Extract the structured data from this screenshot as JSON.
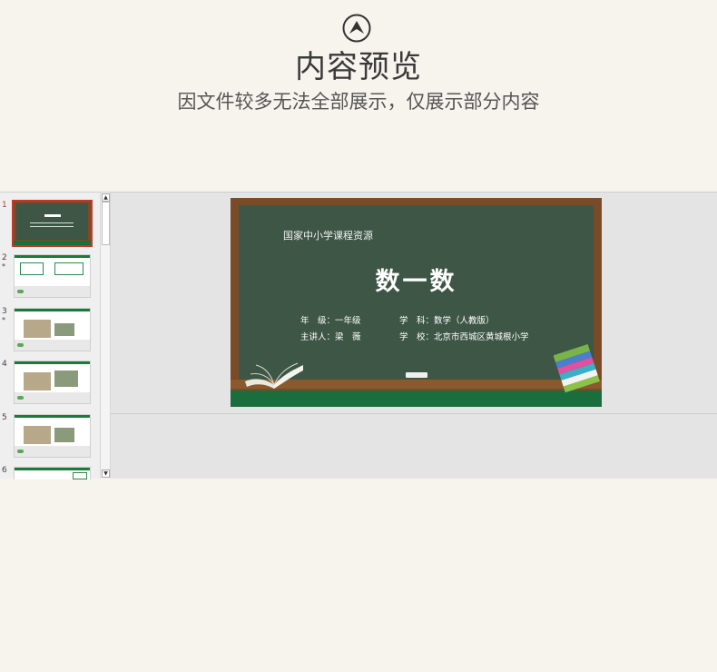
{
  "header": {
    "logo_icon": "double-chevron-up-icon",
    "title": "内容预览",
    "subtitle": "因文件较多无法全部展示，仅展示部分内容"
  },
  "viewer": {
    "thumbnails": [
      {
        "num": "1",
        "star": "",
        "active": true
      },
      {
        "num": "2",
        "star": "*",
        "active": false
      },
      {
        "num": "3",
        "star": "*",
        "active": false
      },
      {
        "num": "4",
        "star": "",
        "active": false
      },
      {
        "num": "5",
        "star": "",
        "active": false
      },
      {
        "num": "6",
        "star": "",
        "active": false
      }
    ],
    "slide": {
      "school_label": "国家中小学课程资源",
      "title": "数一数",
      "grade": "年　级：一年级",
      "subject": "学　科：数学（人教版）",
      "teacher": "主讲人：梁　薇",
      "school": "学　校：北京市西城区黄城根小学"
    }
  },
  "colors": {
    "background": "#f7f4ee",
    "board": "#3d5646",
    "frame": "#7a4b26",
    "active_border": "#c0392b"
  }
}
